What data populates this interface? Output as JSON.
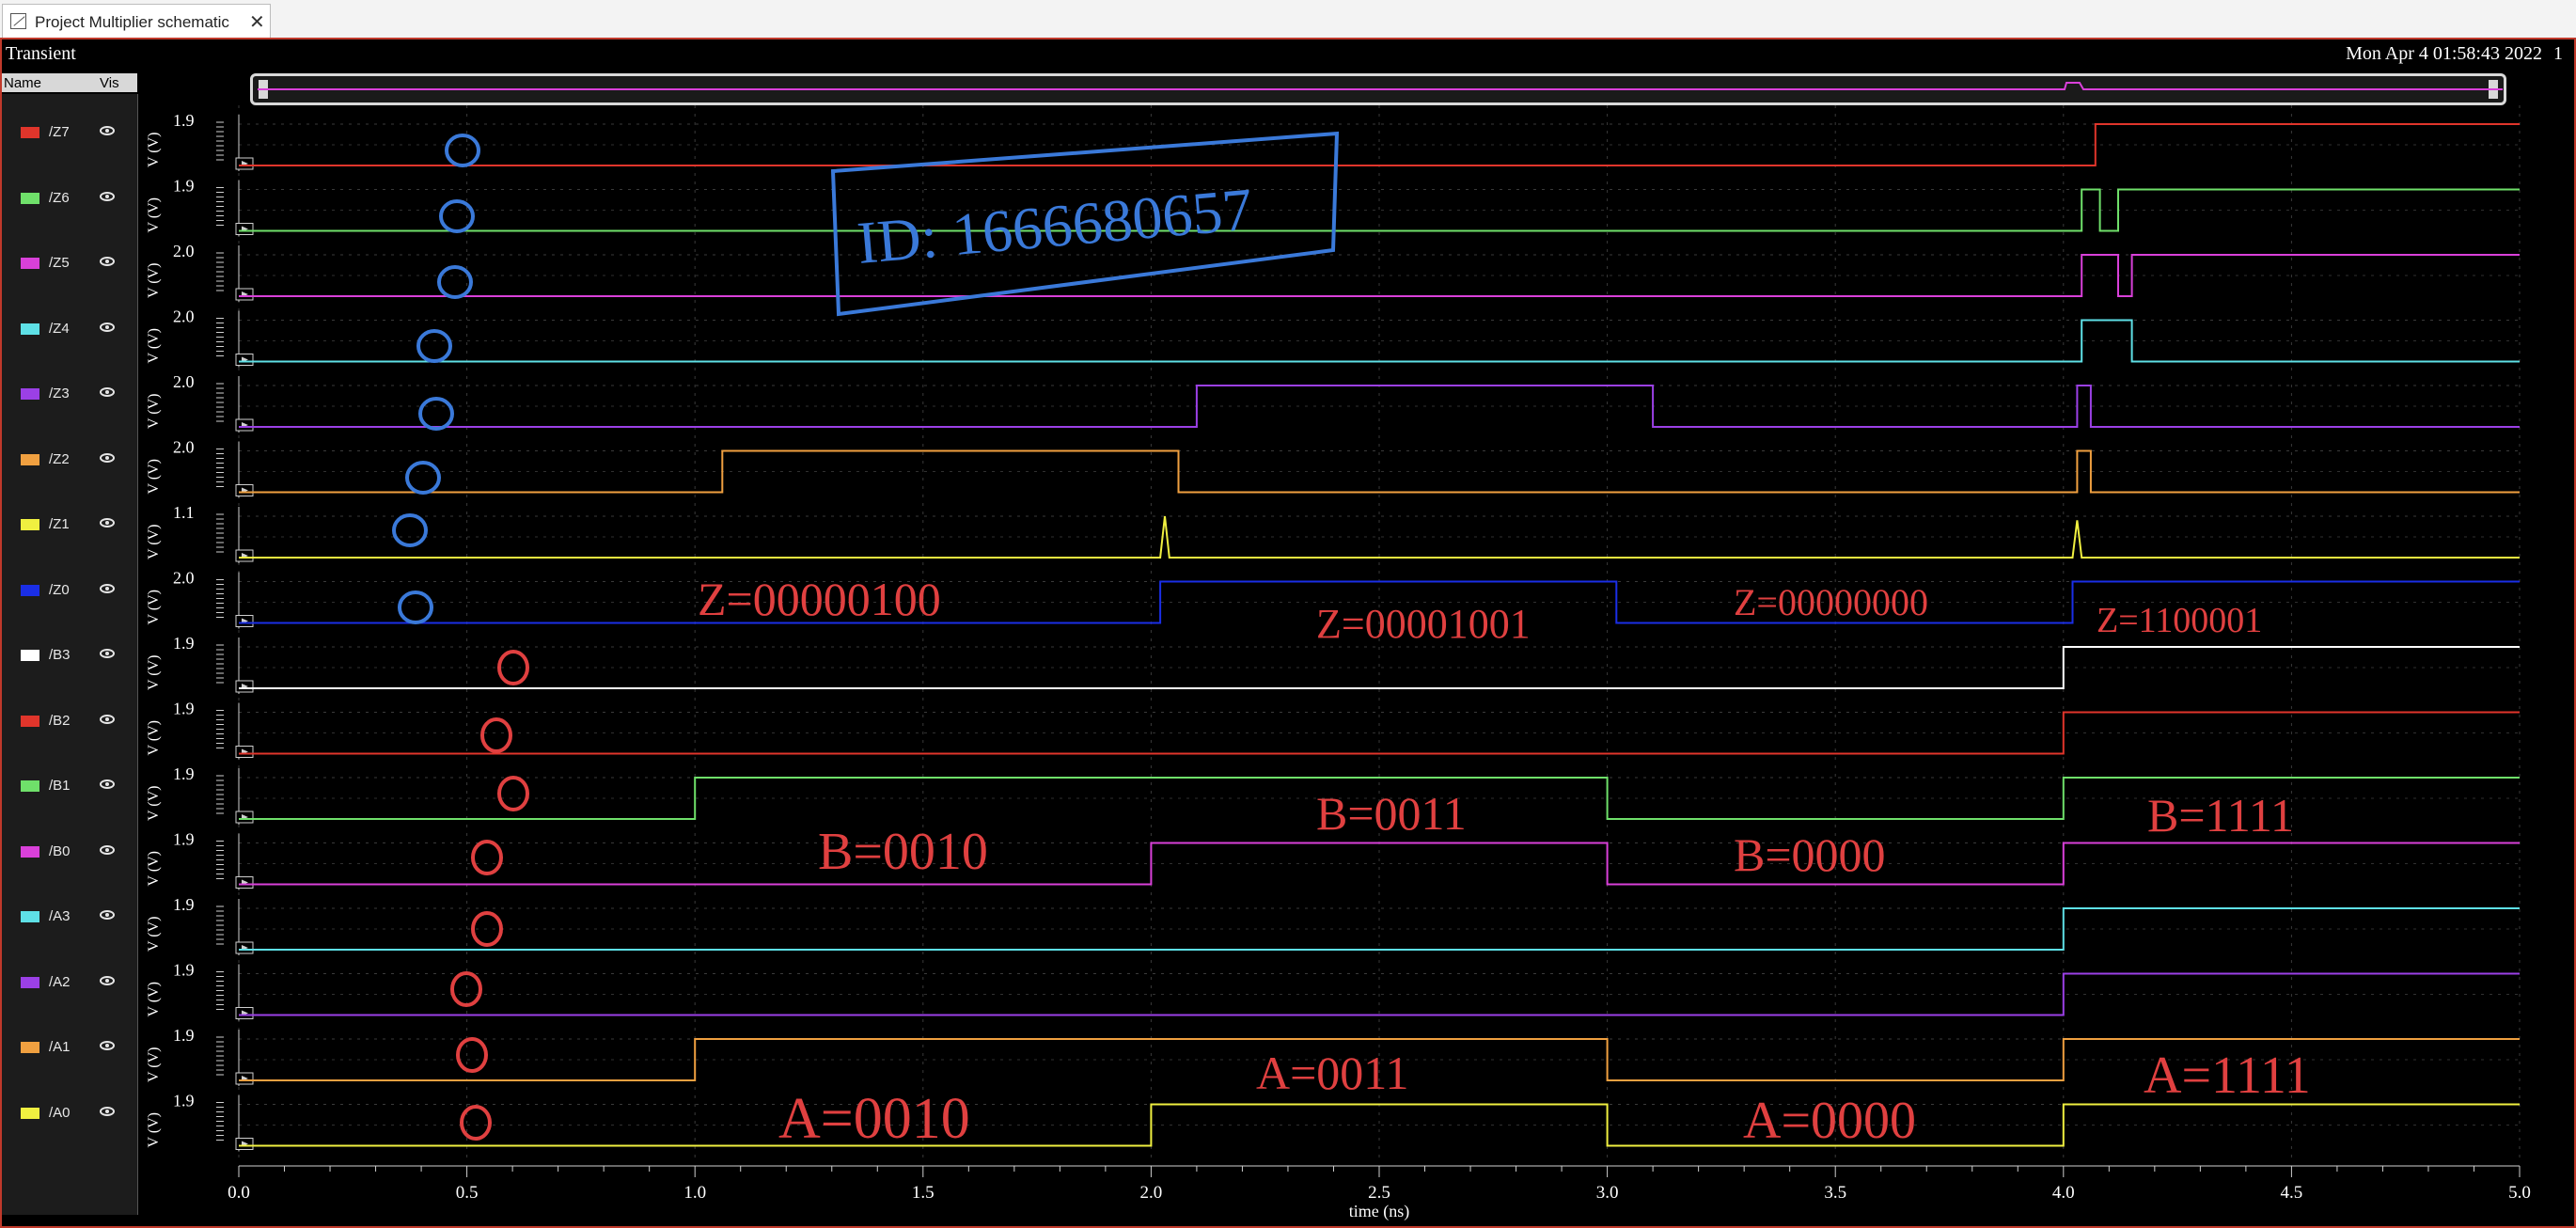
{
  "tab": {
    "title": "Project Multiplier schematic",
    "close": "✕"
  },
  "header": {
    "title": "Transient",
    "date": "Mon Apr 4 01:58:43 2022",
    "num": "1"
  },
  "sidebar": {
    "col_name": "Name",
    "col_vis": "Vis"
  },
  "signals": [
    {
      "name": "/Z7",
      "color": "#e0352b",
      "ymax": "1.9"
    },
    {
      "name": "/Z6",
      "color": "#6fe06a",
      "ymax": "1.9"
    },
    {
      "name": "/Z5",
      "color": "#d940d9",
      "ymax": "2.0"
    },
    {
      "name": "/Z4",
      "color": "#5ee0e6",
      "ymax": "2.0"
    },
    {
      "name": "/Z3",
      "color": "#9b40e6",
      "ymax": "2.0"
    },
    {
      "name": "/Z2",
      "color": "#f0a040",
      "ymax": "2.0"
    },
    {
      "name": "/Z1",
      "color": "#f0f040",
      "ymax": "1.1"
    },
    {
      "name": "/Z0",
      "color": "#1a2ee6",
      "ymax": "2.0"
    },
    {
      "name": "/B3",
      "color": "#ffffff",
      "ymax": "1.9"
    },
    {
      "name": "/B2",
      "color": "#e0352b",
      "ymax": "1.9"
    },
    {
      "name": "/B1",
      "color": "#6fe06a",
      "ymax": "1.9"
    },
    {
      "name": "/B0",
      "color": "#d940d9",
      "ymax": "1.9"
    },
    {
      "name": "/A3",
      "color": "#5ee0e6",
      "ymax": "1.9"
    },
    {
      "name": "/A2",
      "color": "#9b40e6",
      "ymax": "1.9"
    },
    {
      "name": "/A1",
      "color": "#f0a040",
      "ymax": "1.9"
    },
    {
      "name": "/A0",
      "color": "#f0f040",
      "ymax": "1.9"
    }
  ],
  "ylabel": "V (V)",
  "xaxis": {
    "ticks": [
      "0.0",
      "0.5",
      "1.0",
      "1.5",
      "2.0",
      "2.5",
      "3.0",
      "3.5",
      "4.0",
      "4.5",
      "5.0"
    ],
    "label": "time (ns)",
    "range_ns": [
      0,
      5
    ]
  },
  "waves": {
    "/Z7": [
      [
        0,
        0
      ],
      [
        4.07,
        0
      ],
      [
        4.07,
        1
      ]
    ],
    "/Z6": [
      [
        0,
        0
      ],
      [
        4.04,
        0
      ],
      [
        4.04,
        1
      ],
      [
        4.08,
        1
      ],
      [
        4.08,
        0
      ],
      [
        4.12,
        0
      ],
      [
        4.12,
        1
      ]
    ],
    "/Z5": [
      [
        0,
        0
      ],
      [
        4.04,
        0
      ],
      [
        4.04,
        1
      ],
      [
        4.12,
        1
      ],
      [
        4.12,
        0
      ],
      [
        4.15,
        0
      ],
      [
        4.15,
        1
      ]
    ],
    "/Z4": [
      [
        0,
        0
      ],
      [
        4.04,
        0
      ],
      [
        4.04,
        1
      ],
      [
        4.15,
        1
      ],
      [
        4.15,
        0
      ]
    ],
    "/Z3": [
      [
        0,
        0
      ],
      [
        2.1,
        0
      ],
      [
        2.1,
        1
      ],
      [
        3.1,
        1
      ],
      [
        3.1,
        0
      ],
      [
        4.03,
        0
      ],
      [
        4.03,
        1
      ],
      [
        4.06,
        1
      ],
      [
        4.06,
        0
      ]
    ],
    "/Z2": [
      [
        0,
        0
      ],
      [
        1.06,
        0
      ],
      [
        1.06,
        1
      ],
      [
        2.06,
        1
      ],
      [
        2.06,
        0
      ],
      [
        4.03,
        0
      ],
      [
        4.03,
        1
      ],
      [
        4.06,
        1
      ],
      [
        4.06,
        0
      ]
    ],
    "/Z1": [
      [
        0,
        0
      ],
      [
        2.02,
        0
      ],
      [
        2.03,
        1
      ],
      [
        2.04,
        0
      ],
      [
        4.02,
        0
      ],
      [
        4.03,
        0.9
      ],
      [
        4.04,
        0
      ]
    ],
    "/Z0": [
      [
        0,
        0
      ],
      [
        2.02,
        0
      ],
      [
        2.02,
        1
      ],
      [
        3.02,
        1
      ],
      [
        3.02,
        0
      ],
      [
        4.02,
        0
      ],
      [
        4.02,
        1
      ]
    ],
    "/B3": [
      [
        0,
        0
      ],
      [
        4.0,
        0
      ],
      [
        4.0,
        1
      ]
    ],
    "/B2": [
      [
        0,
        0
      ],
      [
        4.0,
        0
      ],
      [
        4.0,
        1
      ]
    ],
    "/B1": [
      [
        0,
        0
      ],
      [
        1.0,
        0
      ],
      [
        1.0,
        1
      ],
      [
        3.0,
        1
      ],
      [
        3.0,
        0
      ],
      [
        4.0,
        0
      ],
      [
        4.0,
        1
      ]
    ],
    "/B0": [
      [
        0,
        0
      ],
      [
        2.0,
        0
      ],
      [
        2.0,
        1
      ],
      [
        3.0,
        1
      ],
      [
        3.0,
        0
      ],
      [
        4.0,
        0
      ],
      [
        4.0,
        1
      ]
    ],
    "/A3": [
      [
        0,
        0
      ],
      [
        4.0,
        0
      ],
      [
        4.0,
        1
      ]
    ],
    "/A2": [
      [
        0,
        0
      ],
      [
        4.0,
        0
      ],
      [
        4.0,
        1
      ]
    ],
    "/A1": [
      [
        0,
        0
      ],
      [
        1.0,
        0
      ],
      [
        1.0,
        1
      ],
      [
        3.0,
        1
      ],
      [
        3.0,
        0
      ],
      [
        4.0,
        0
      ],
      [
        4.0,
        1
      ]
    ],
    "/A0": [
      [
        0,
        0
      ],
      [
        2.0,
        0
      ],
      [
        2.0,
        1
      ],
      [
        3.0,
        1
      ],
      [
        3.0,
        0
      ],
      [
        4.0,
        0
      ],
      [
        4.0,
        1
      ]
    ]
  },
  "annotations": {
    "id": "ID: 1666680657",
    "z1": "Z=00000100",
    "z2": "Z=00001001",
    "z3": "Z=00000000",
    "z4": "Z=1100001",
    "b1": "B=0010",
    "b2": "B=0011",
    "b3": "B=0000",
    "b4": "B=1111",
    "a1": "A=0010",
    "a2": "A=0011",
    "a3": "A=0000",
    "a4": "A=1111",
    "zeros": "0"
  }
}
